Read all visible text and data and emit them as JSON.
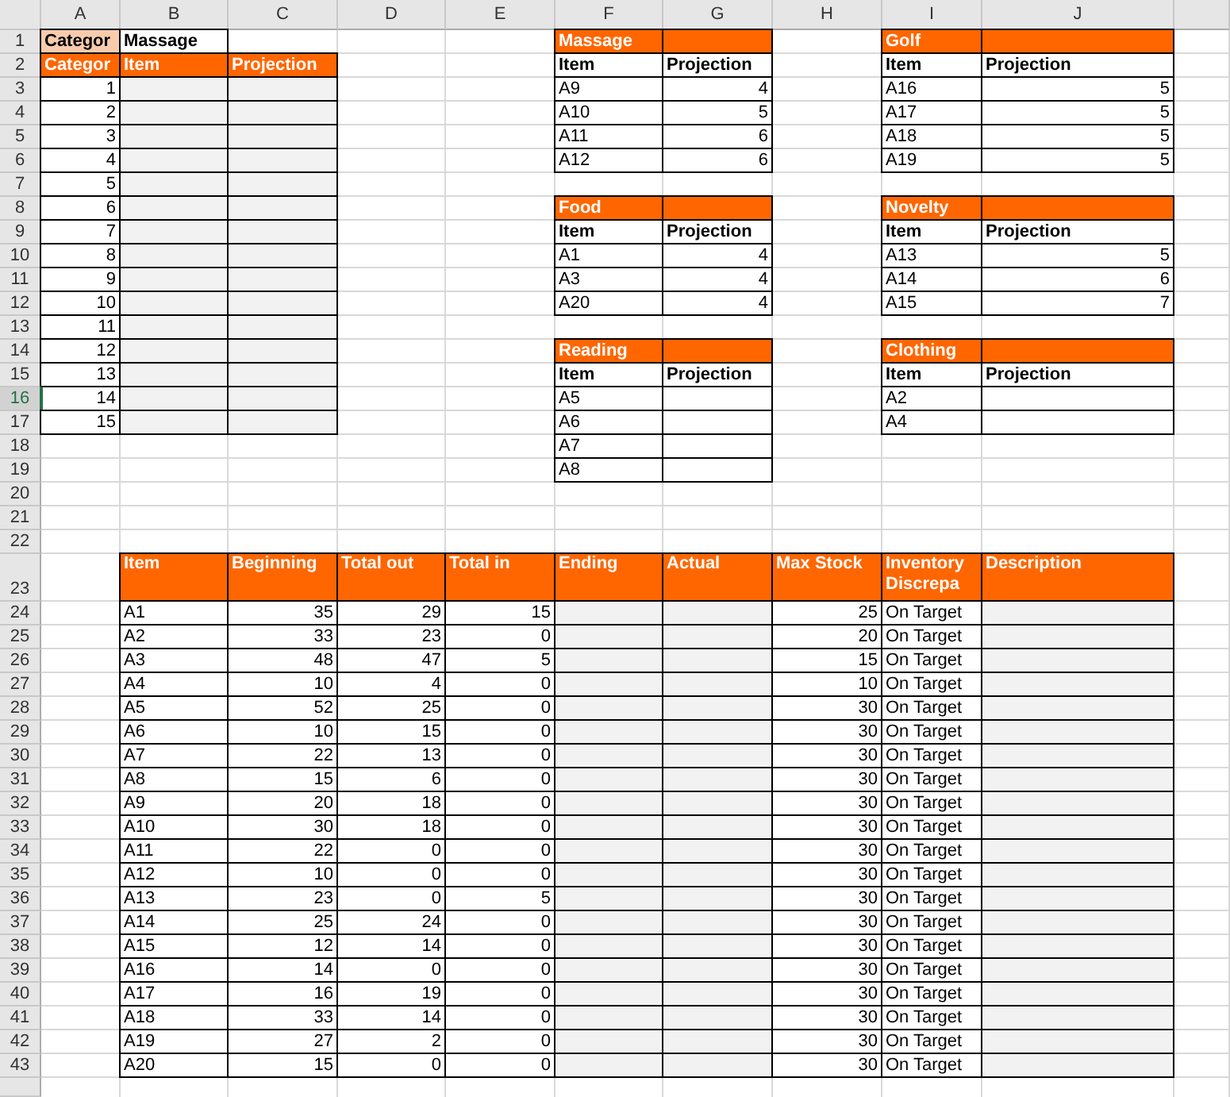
{
  "column_headers": [
    {
      "label": "A",
      "selected": false
    },
    {
      "label": "B",
      "selected": false
    },
    {
      "label": "C",
      "selected": false
    },
    {
      "label": "D",
      "selected": false
    },
    {
      "label": "E",
      "selected": false
    },
    {
      "label": "F",
      "selected": false
    },
    {
      "label": "G",
      "selected": false
    },
    {
      "label": "H",
      "selected": false
    },
    {
      "label": "I",
      "selected": false
    },
    {
      "label": "J",
      "selected": false
    }
  ],
  "row_headers": [
    {
      "label": "1",
      "selected": false
    },
    {
      "label": "2",
      "selected": false
    },
    {
      "label": "3",
      "selected": false
    },
    {
      "label": "4",
      "selected": false
    },
    {
      "label": "5",
      "selected": false
    },
    {
      "label": "6",
      "selected": false
    },
    {
      "label": "7",
      "selected": false
    },
    {
      "label": "8",
      "selected": false
    },
    {
      "label": "9",
      "selected": false
    },
    {
      "label": "10",
      "selected": false
    },
    {
      "label": "11",
      "selected": false
    },
    {
      "label": "12",
      "selected": false
    },
    {
      "label": "13",
      "selected": false
    },
    {
      "label": "14",
      "selected": false
    },
    {
      "label": "15",
      "selected": false
    },
    {
      "label": "16",
      "selected": true
    },
    {
      "label": "17",
      "selected": false
    },
    {
      "label": "18",
      "selected": false
    },
    {
      "label": "19",
      "selected": false
    },
    {
      "label": "20",
      "selected": false
    },
    {
      "label": "21",
      "selected": false
    },
    {
      "label": "22",
      "selected": false
    },
    {
      "label": "23",
      "selected": false
    },
    {
      "label": "24",
      "selected": false
    },
    {
      "label": "25",
      "selected": false
    },
    {
      "label": "26",
      "selected": false
    },
    {
      "label": "27",
      "selected": false
    },
    {
      "label": "28",
      "selected": false
    },
    {
      "label": "29",
      "selected": false
    },
    {
      "label": "30",
      "selected": false
    },
    {
      "label": "31",
      "selected": false
    },
    {
      "label": "32",
      "selected": false
    },
    {
      "label": "33",
      "selected": false
    },
    {
      "label": "34",
      "selected": false
    },
    {
      "label": "35",
      "selected": false
    },
    {
      "label": "36",
      "selected": false
    },
    {
      "label": "37",
      "selected": false
    },
    {
      "label": "38",
      "selected": false
    },
    {
      "label": "39",
      "selected": false
    },
    {
      "label": "40",
      "selected": false
    },
    {
      "label": "41",
      "selected": false
    },
    {
      "label": "42",
      "selected": false
    },
    {
      "label": "43",
      "selected": false
    }
  ],
  "category_picker": {
    "label": "Categor",
    "value": "Massage"
  },
  "category_table": {
    "columns": [
      "Categor",
      "Item",
      "Projection"
    ],
    "rows": [
      "1",
      "2",
      "3",
      "4",
      "5",
      "6",
      "7",
      "8",
      "9",
      "10",
      "11",
      "12",
      "13",
      "14",
      "15"
    ]
  },
  "groups": [
    {
      "title": "Massage",
      "columns": [
        "Item",
        "Projection"
      ],
      "rows": [
        {
          "item": "A9",
          "projection": "4"
        },
        {
          "item": "A10",
          "projection": "5"
        },
        {
          "item": "A11",
          "projection": "6"
        },
        {
          "item": "A12",
          "projection": "6"
        }
      ]
    },
    {
      "title": "Golf",
      "columns": [
        "Item",
        "Projection"
      ],
      "rows": [
        {
          "item": "A16",
          "projection": "5"
        },
        {
          "item": "A17",
          "projection": "5"
        },
        {
          "item": "A18",
          "projection": "5"
        },
        {
          "item": "A19",
          "projection": "5"
        }
      ]
    },
    {
      "title": "Food",
      "columns": [
        "Item",
        "Projection"
      ],
      "rows": [
        {
          "item": "A1",
          "projection": "4"
        },
        {
          "item": "A3",
          "projection": "4"
        },
        {
          "item": "A20",
          "projection": "4"
        }
      ]
    },
    {
      "title": "Novelty",
      "columns": [
        "Item",
        "Projection"
      ],
      "rows": [
        {
          "item": "A13",
          "projection": "5"
        },
        {
          "item": "A14",
          "projection": "6"
        },
        {
          "item": "A15",
          "projection": "7"
        }
      ]
    },
    {
      "title": "Reading",
      "columns": [
        "Item",
        "Projection"
      ],
      "rows": [
        {
          "item": "A5"
        },
        {
          "item": "A6"
        },
        {
          "item": "A7"
        },
        {
          "item": "A8"
        }
      ]
    },
    {
      "title": "Clothing",
      "columns": [
        "Item",
        "Projection"
      ],
      "rows": [
        {
          "item": "A2"
        },
        {
          "item": "A4"
        }
      ]
    }
  ],
  "inventory": {
    "columns": [
      "Item",
      "Beginning",
      "Total out",
      "Total in",
      "Ending",
      "Actual",
      "Max Stock",
      "Inventory Discrepa",
      "Description"
    ],
    "rows": [
      {
        "item": "A1",
        "beginning": "35",
        "total_out": "29",
        "total_in": "15",
        "max_stock": "25",
        "discrepancy": "On Target"
      },
      {
        "item": "A2",
        "beginning": "33",
        "total_out": "23",
        "total_in": "0",
        "max_stock": "20",
        "discrepancy": "On Target"
      },
      {
        "item": "A3",
        "beginning": "48",
        "total_out": "47",
        "total_in": "5",
        "max_stock": "15",
        "discrepancy": "On Target"
      },
      {
        "item": "A4",
        "beginning": "10",
        "total_out": "4",
        "total_in": "0",
        "max_stock": "10",
        "discrepancy": "On Target"
      },
      {
        "item": "A5",
        "beginning": "52",
        "total_out": "25",
        "total_in": "0",
        "max_stock": "30",
        "discrepancy": "On Target"
      },
      {
        "item": "A6",
        "beginning": "10",
        "total_out": "15",
        "total_in": "0",
        "max_stock": "30",
        "discrepancy": "On Target"
      },
      {
        "item": "A7",
        "beginning": "22",
        "total_out": "13",
        "total_in": "0",
        "max_stock": "30",
        "discrepancy": "On Target"
      },
      {
        "item": "A8",
        "beginning": "15",
        "total_out": "6",
        "total_in": "0",
        "max_stock": "30",
        "discrepancy": "On Target"
      },
      {
        "item": "A9",
        "beginning": "20",
        "total_out": "18",
        "total_in": "0",
        "max_stock": "30",
        "discrepancy": "On Target"
      },
      {
        "item": "A10",
        "beginning": "30",
        "total_out": "18",
        "total_in": "0",
        "max_stock": "30",
        "discrepancy": "On Target"
      },
      {
        "item": "A11",
        "beginning": "22",
        "total_out": "0",
        "total_in": "0",
        "max_stock": "30",
        "discrepancy": "On Target"
      },
      {
        "item": "A12",
        "beginning": "10",
        "total_out": "0",
        "total_in": "0",
        "max_stock": "30",
        "discrepancy": "On Target"
      },
      {
        "item": "A13",
        "beginning": "23",
        "total_out": "0",
        "total_in": "5",
        "max_stock": "30",
        "discrepancy": "On Target"
      },
      {
        "item": "A14",
        "beginning": "25",
        "total_out": "24",
        "total_in": "0",
        "max_stock": "30",
        "discrepancy": "On Target"
      },
      {
        "item": "A15",
        "beginning": "12",
        "total_out": "14",
        "total_in": "0",
        "max_stock": "30",
        "discrepancy": "On Target"
      },
      {
        "item": "A16",
        "beginning": "14",
        "total_out": "0",
        "total_in": "0",
        "max_stock": "30",
        "discrepancy": "On Target"
      },
      {
        "item": "A17",
        "beginning": "16",
        "total_out": "19",
        "total_in": "0",
        "max_stock": "30",
        "discrepancy": "On Target"
      },
      {
        "item": "A18",
        "beginning": "33",
        "total_out": "14",
        "total_in": "0",
        "max_stock": "30",
        "discrepancy": "On Target"
      },
      {
        "item": "A19",
        "beginning": "27",
        "total_out": "2",
        "total_in": "0",
        "max_stock": "30",
        "discrepancy": "On Target"
      },
      {
        "item": "A20",
        "beginning": "15",
        "total_out": "0",
        "total_in": "0",
        "max_stock": "30",
        "discrepancy": "On Target"
      }
    ]
  }
}
